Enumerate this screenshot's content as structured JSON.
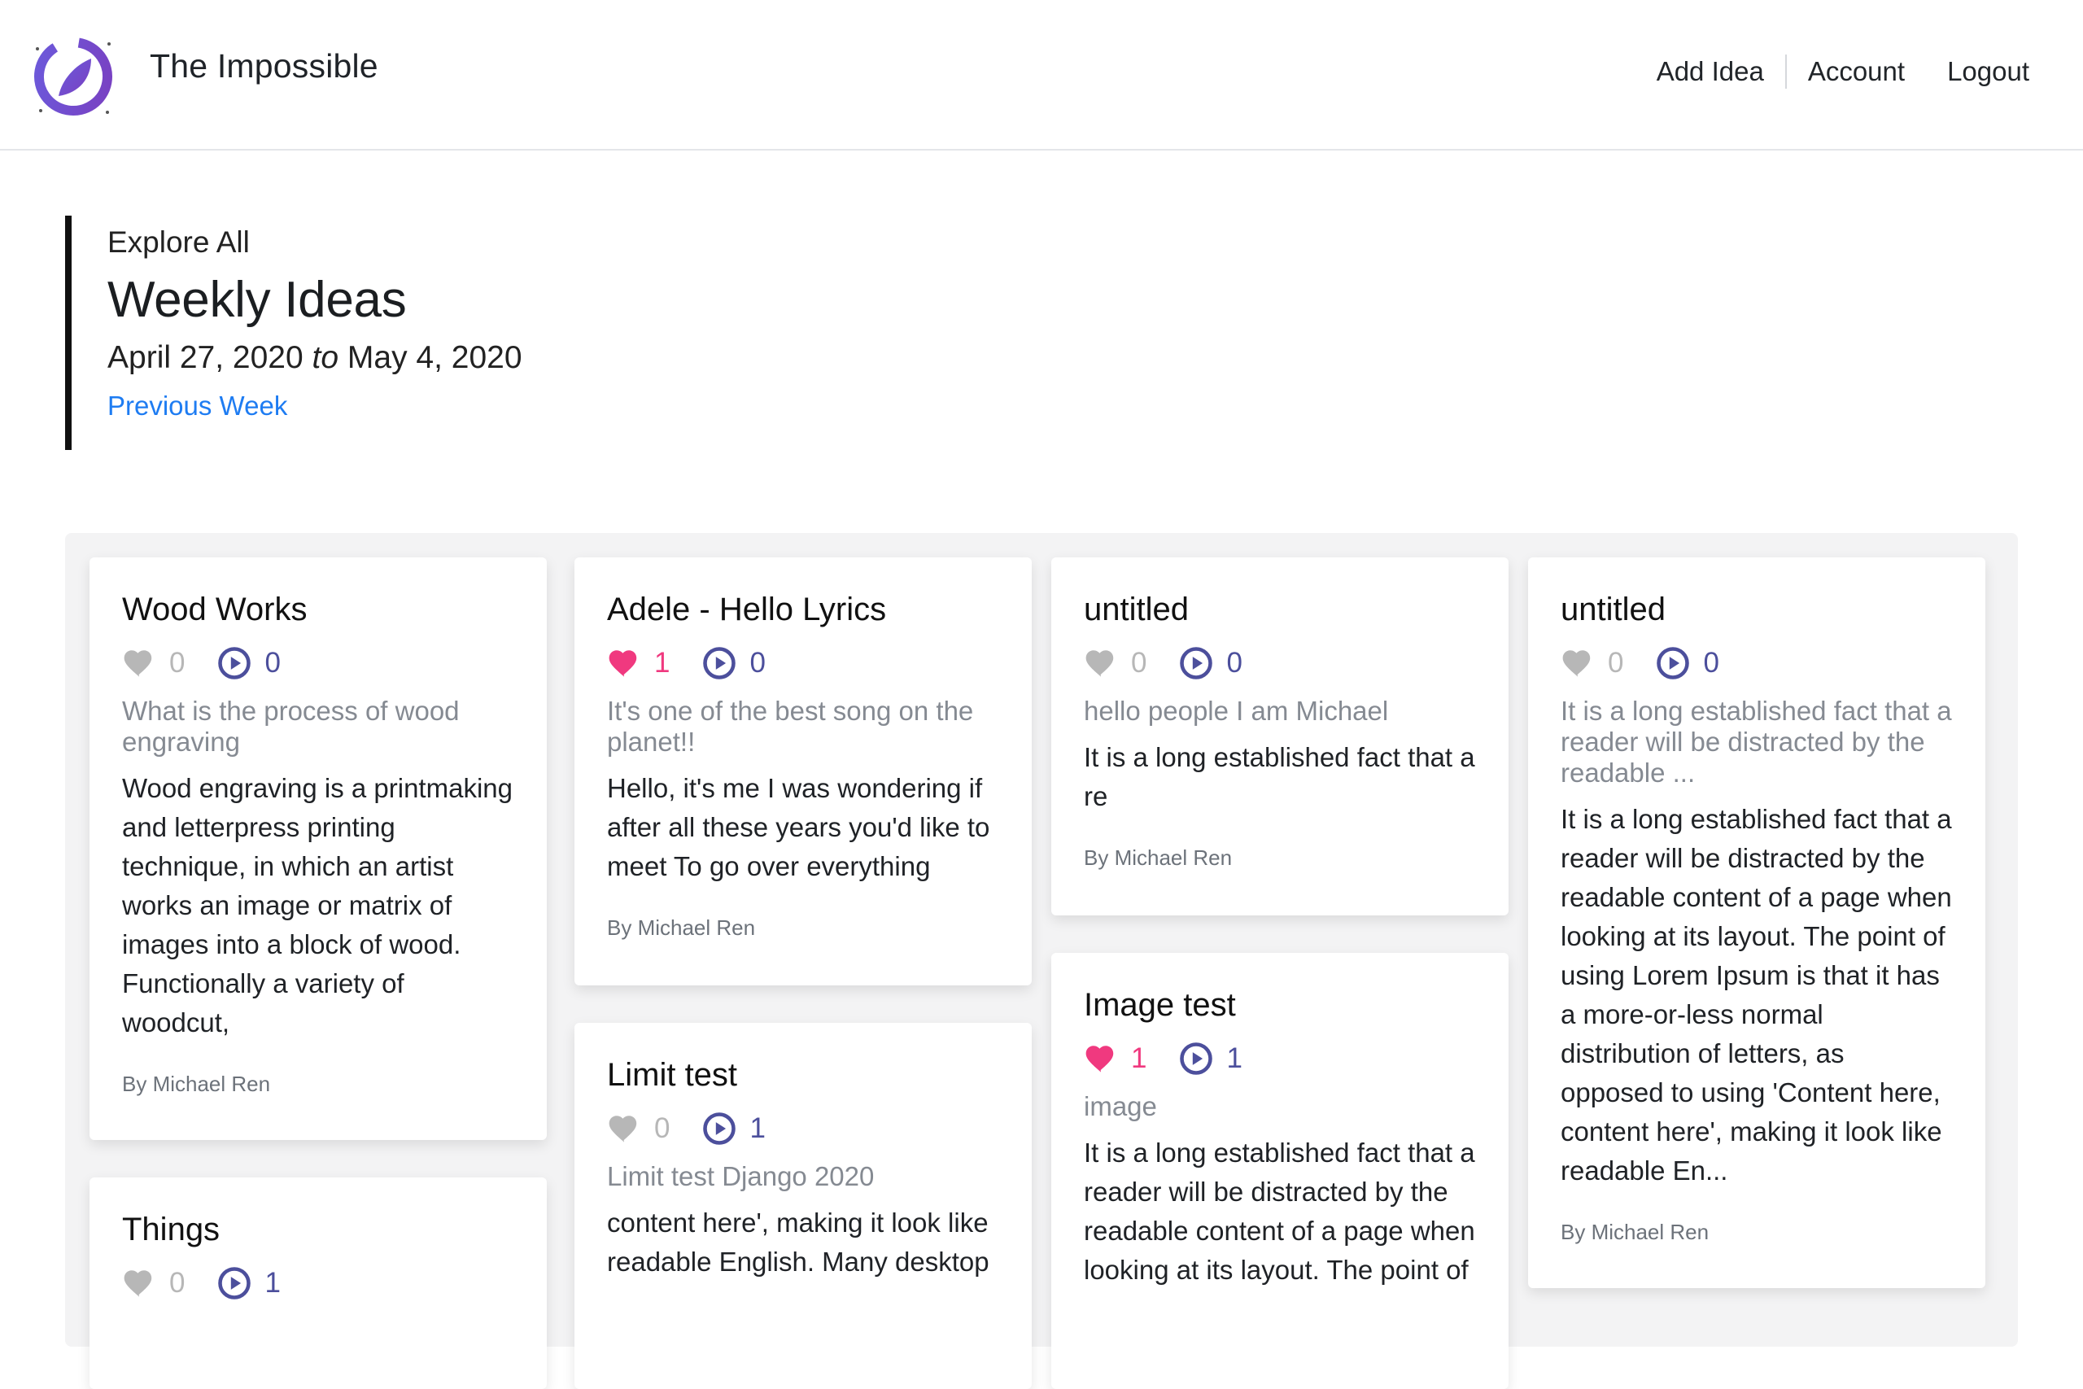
{
  "header": {
    "brand": "The Impossible",
    "nav": {
      "add_idea": "Add Idea",
      "account": "Account",
      "logout": "Logout"
    }
  },
  "intro": {
    "eyebrow": "Explore All",
    "title": "Weekly Ideas",
    "range_start": "April 27, 2020",
    "range_sep": "to",
    "range_end": "May 4, 2020",
    "previous": "Previous Week"
  },
  "colors": {
    "accent": "#1e7cf2",
    "like_active": "#f0397f",
    "like_inactive": "#b7b7b7",
    "play": "#4c4f9c"
  },
  "icons": {
    "like": "heart-icon",
    "play": "play-icon",
    "logo": "logo-icon"
  },
  "cards": [
    {
      "title": "Wood Works",
      "likes": "0",
      "liked": false,
      "plays": "0",
      "subtitle": "What is the process of wood engraving",
      "body": "Wood engraving is a printmaking and letterpress printing technique, in which an artist works an image or matrix of images into a block of wood. Functionally a variety of woodcut,",
      "author": "By Michael Ren"
    },
    {
      "title": "Things",
      "likes": "0",
      "liked": false,
      "plays": "1"
    },
    {
      "title": "Adele - Hello Lyrics",
      "likes": "1",
      "liked": true,
      "plays": "0",
      "subtitle": "It's one of the best song on the planet!!",
      "body": "Hello, it's me I was wondering if after all these years you'd like to meet To go over everything",
      "author": "By Michael Ren"
    },
    {
      "title": "Limit test",
      "likes": "0",
      "liked": false,
      "plays": "1",
      "subtitle": "Limit test Django 2020",
      "body": "content here', making it look like readable English. Many desktop"
    },
    {
      "title": "untitled",
      "likes": "0",
      "liked": false,
      "plays": "0",
      "subtitle": "hello people I am Michael",
      "body": "It is a long established fact that a re",
      "author": "By Michael Ren"
    },
    {
      "title": "Image test",
      "likes": "1",
      "liked": true,
      "plays": "1",
      "subtitle": "image",
      "body": "It is a long established fact that a reader will be distracted by the readable content of a page when looking at its layout. The point of"
    },
    {
      "title": "untitled",
      "likes": "0",
      "liked": false,
      "plays": "0",
      "subtitle": "It is a long established fact that a reader will be distracted by the readable ...",
      "body": "It is a long established fact that a reader will be distracted by the readable content of a page when looking at its layout. The point of using Lorem Ipsum is that it has a more-or-less normal distribution of letters, as opposed to using 'Content here, content here', making it look like readable En...",
      "author": "By Michael Ren"
    }
  ]
}
